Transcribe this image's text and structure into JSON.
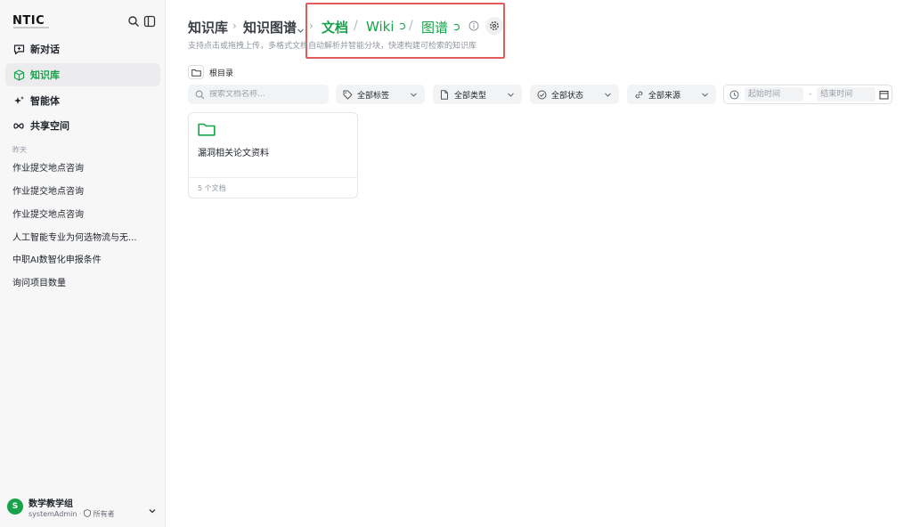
{
  "sidebar": {
    "logo": "NTIC",
    "nav": [
      {
        "label": "新对话",
        "icon": "chat-plus-icon"
      },
      {
        "label": "知识库",
        "icon": "cube-icon",
        "active": true
      },
      {
        "label": "智能体",
        "icon": "sparkle-icon"
      },
      {
        "label": "共享空间",
        "icon": "infinity-icon"
      }
    ],
    "section_label": "昨天",
    "history": [
      "作业提交地点咨询",
      "作业提交地点咨询",
      "作业提交地点咨询",
      "人工智能专业为何选物流与无...",
      "中职AI数智化申报条件",
      "询问项目数量"
    ],
    "user": {
      "avatar": "S",
      "name": "数学教学组",
      "account": "systemAdmin",
      "role": "所有者"
    }
  },
  "header": {
    "crumb1": "知识库",
    "crumb2": "知识图谱",
    "tabs": {
      "docs": "文档",
      "wiki": "Wiki",
      "graph": "图谱"
    },
    "subtitle": "支持点击或拖拽上传，多格式文档自动解析并智能分块，快速构建可检索的知识库"
  },
  "toolbar": {
    "root_label": "根目录",
    "search_placeholder": "搜索文档名称...",
    "filters": {
      "tags": "全部标签",
      "types": "全部类型",
      "status": "全部状态",
      "source": "全部来源"
    },
    "start_placeholder": "起始时间",
    "end_placeholder": "结束时间",
    "date_dash": "-"
  },
  "cards": [
    {
      "title": "漏洞相关论文资料",
      "count": "5 个文档"
    }
  ],
  "colors": {
    "accent": "#16a34a",
    "highlight": "#e35b5b"
  }
}
